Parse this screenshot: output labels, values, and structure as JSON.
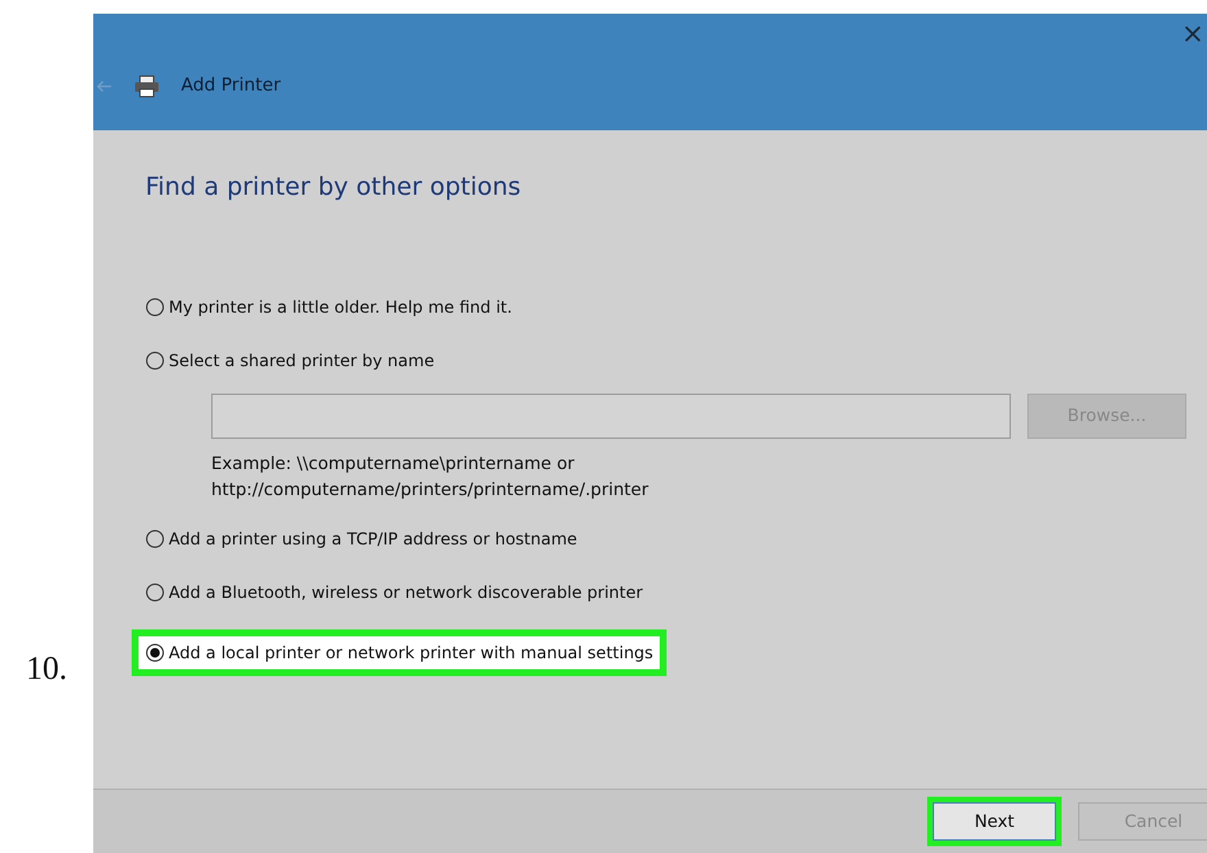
{
  "step_number": "10.",
  "window": {
    "title": "Add Printer",
    "close": "×"
  },
  "heading": "Find a printer by other options",
  "options": [
    {
      "label": "My printer is a little older. Help me find it.",
      "selected": false,
      "highlighted": false
    },
    {
      "label": "Select a shared printer by name",
      "selected": false,
      "highlighted": false,
      "field": {
        "button": "Browse...",
        "example": [
          "Example: \\\\computername\\printername or",
          "http://computername/printers/printername/.printer"
        ]
      }
    },
    {
      "label": "Add a printer using a TCP/IP address or hostname",
      "selected": false,
      "highlighted": false
    },
    {
      "label": "Add a Bluetooth, wireless or network discoverable printer",
      "selected": false,
      "highlighted": false
    },
    {
      "label": "Add a local printer or network printer with manual settings",
      "selected": true,
      "highlighted": true
    }
  ],
  "buttons": [
    {
      "label": "Next",
      "highlighted": true
    },
    {
      "label": "Cancel",
      "highlighted": false
    }
  ]
}
